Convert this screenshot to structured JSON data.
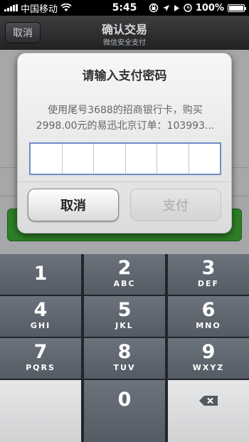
{
  "status_bar": {
    "carrier": "中国移动",
    "time": "5:45",
    "battery": "100%",
    "battery_level": 1.0
  },
  "nav": {
    "cancel_label": "取消",
    "title": "确认交易",
    "subtitle": "微信安全支付"
  },
  "dialog": {
    "title": "请输入支付密码",
    "message_line1": "使用尾号3688的招商银行卡，购买",
    "message_line2": "2998.00元的易迅北京订单：103993...",
    "pin_length": 6,
    "cancel_label": "取消",
    "pay_label": "支付"
  },
  "keypad": {
    "keys": [
      {
        "num": "1",
        "letters": ""
      },
      {
        "num": "2",
        "letters": "ABC"
      },
      {
        "num": "3",
        "letters": "DEF"
      },
      {
        "num": "4",
        "letters": "GHI"
      },
      {
        "num": "5",
        "letters": "JKL"
      },
      {
        "num": "6",
        "letters": "MNO"
      },
      {
        "num": "7",
        "letters": "PQRS"
      },
      {
        "num": "8",
        "letters": "TUV"
      },
      {
        "num": "9",
        "letters": "WXYZ"
      },
      {
        "num": "0",
        "letters": ""
      }
    ]
  },
  "icons": {
    "wifi": "wifi-icon",
    "rotation_lock": "rotation-lock-icon",
    "location": "location-arrow-icon",
    "play": "play-icon",
    "alarm": "alarm-icon",
    "battery": "battery-icon",
    "delete": "backspace-icon"
  }
}
